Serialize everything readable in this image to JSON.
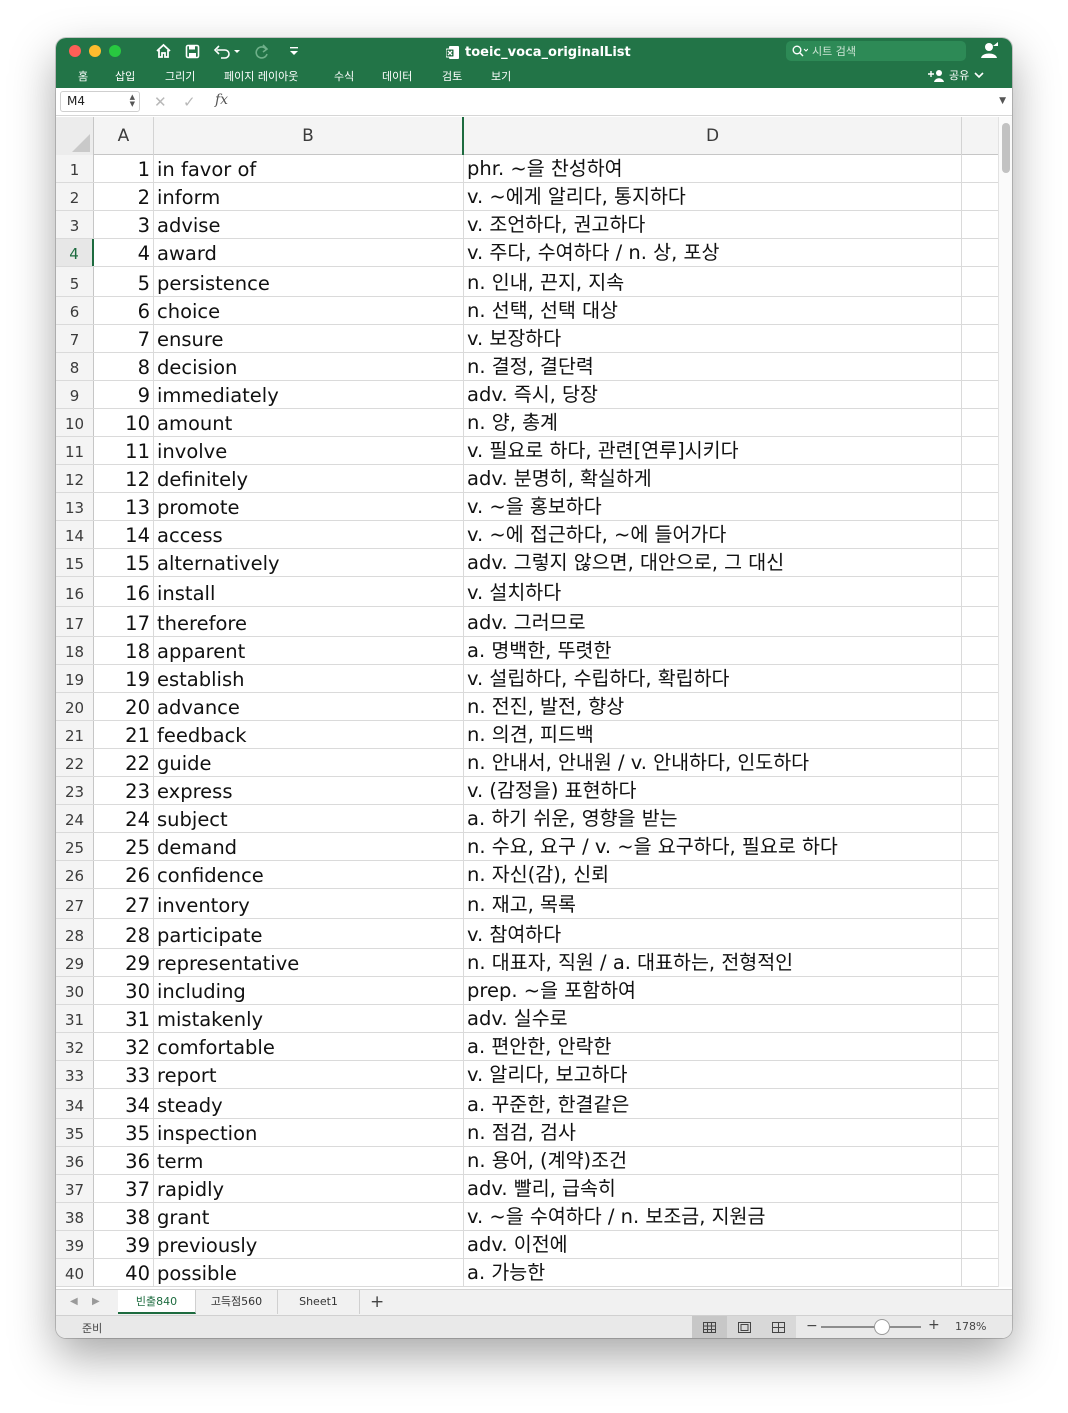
{
  "window": {
    "title": "toeic_voca_originalList",
    "search_placeholder": "시트 검색",
    "share_label": "공유"
  },
  "menu": [
    "홈",
    "삽입",
    "그리기",
    "페이지 레이아웃",
    "수식",
    "데이터",
    "검토",
    "보기"
  ],
  "formula_bar": {
    "cell_ref": "M4",
    "fx": "fx",
    "formula": ""
  },
  "columns": [
    "A",
    "B",
    "D"
  ],
  "rows": [
    {
      "r": "1",
      "n": "1",
      "word": "in favor of",
      "meaning": "phr.  ~을 찬성하여"
    },
    {
      "r": "2",
      "n": "2",
      "word": "inform",
      "meaning": "v. ~에게 알리다, 통지하다"
    },
    {
      "r": "3",
      "n": "3",
      "word": "advise",
      "meaning": "v. 조언하다, 권고하다"
    },
    {
      "r": "4",
      "n": "4",
      "word": "award",
      "meaning": "v. 주다, 수여하다 / n. 상, 포상"
    },
    {
      "r": "5",
      "n": "5",
      "word": "persistence",
      "meaning": "n. 인내, 끈지, 지속"
    },
    {
      "r": "6",
      "n": "6",
      "word": "choice",
      "meaning": "n. 선택, 선택 대상"
    },
    {
      "r": "7",
      "n": "7",
      "word": "ensure",
      "meaning": "v. 보장하다"
    },
    {
      "r": "8",
      "n": "8",
      "word": "decision",
      "meaning": "n. 결정, 결단력"
    },
    {
      "r": "9",
      "n": "9",
      "word": "immediately",
      "meaning": "adv. 즉시, 당장"
    },
    {
      "r": "10",
      "n": "10",
      "word": "amount",
      "meaning": "n. 양, 총계"
    },
    {
      "r": "11",
      "n": "11",
      "word": "involve",
      "meaning": "v. 필요로 하다, 관련[연루]시키다"
    },
    {
      "r": "12",
      "n": "12",
      "word": "definitely",
      "meaning": "adv. 분명히, 확실하게"
    },
    {
      "r": "13",
      "n": "13",
      "word": "promote",
      "meaning": "v. ~을 홍보하다"
    },
    {
      "r": "14",
      "n": "14",
      "word": "access",
      "meaning": "v. ~에 접근하다, ~에 들어가다"
    },
    {
      "r": "15",
      "n": "15",
      "word": "alternatively",
      "meaning": "adv. 그렇지 않으면, 대안으로, 그 대신"
    },
    {
      "r": "16",
      "n": "16",
      "word": "install",
      "meaning": "v. 설치하다"
    },
    {
      "r": "17",
      "n": "17",
      "word": "therefore",
      "meaning": "adv. 그러므로"
    },
    {
      "r": "18",
      "n": "18",
      "word": "apparent",
      "meaning": "a.  명백한, 뚜렷한"
    },
    {
      "r": "19",
      "n": "19",
      "word": "establish",
      "meaning": "v. 설립하다, 수립하다, 확립하다"
    },
    {
      "r": "20",
      "n": "20",
      "word": "advance",
      "meaning": "n. 전진, 발전, 향상"
    },
    {
      "r": "21",
      "n": "21",
      "word": "feedback",
      "meaning": "n. 의견, 피드백"
    },
    {
      "r": "22",
      "n": "22",
      "word": "guide",
      "meaning": "n. 안내서, 안내원 / v. 안내하다, 인도하다"
    },
    {
      "r": "23",
      "n": "23",
      "word": "express",
      "meaning": "v. (감정을) 표현하다"
    },
    {
      "r": "24",
      "n": "24",
      "word": "subject",
      "meaning": "a.  하기 쉬운, 영향을 받는"
    },
    {
      "r": "25",
      "n": "25",
      "word": "demand",
      "meaning": "n. 수요, 요구 / v. ~을 요구하다, 필요로 하다"
    },
    {
      "r": "26",
      "n": "26",
      "word": "confidence",
      "meaning": "n. 자신(감), 신뢰"
    },
    {
      "r": "27",
      "n": "27",
      "word": "inventory",
      "meaning": "n. 재고, 목록"
    },
    {
      "r": "28",
      "n": "28",
      "word": "participate",
      "meaning": "v. 참여하다"
    },
    {
      "r": "29",
      "n": "29",
      "word": "representative",
      "meaning": "n. 대표자, 직원 / a. 대표하는, 전형적인"
    },
    {
      "r": "30",
      "n": "30",
      "word": "including",
      "meaning": "prep. ~을 포함하여"
    },
    {
      "r": "31",
      "n": "31",
      "word": "mistakenly",
      "meaning": "adv. 실수로"
    },
    {
      "r": "32",
      "n": "32",
      "word": "comfortable",
      "meaning": "a.  편안한, 안락한"
    },
    {
      "r": "33",
      "n": "33",
      "word": "report",
      "meaning": "v. 알리다, 보고하다"
    },
    {
      "r": "34",
      "n": "34",
      "word": "steady",
      "meaning": "a.  꾸준한, 한결같은"
    },
    {
      "r": "35",
      "n": "35",
      "word": "inspection",
      "meaning": "n. 점검, 검사"
    },
    {
      "r": "36",
      "n": "36",
      "word": "term",
      "meaning": "n. 용어, (계약)조건"
    },
    {
      "r": "37",
      "n": "37",
      "word": "rapidly",
      "meaning": "adv. 빨리, 급속히"
    },
    {
      "r": "38",
      "n": "38",
      "word": "grant",
      "meaning": "v. ~을 수여하다 / n. 보조금, 지원금"
    },
    {
      "r": "39",
      "n": "39",
      "word": "previously",
      "meaning": "adv. 이전에"
    },
    {
      "r": "40",
      "n": "40",
      "word": "possible",
      "meaning": "a.  가능한"
    }
  ],
  "active_row": "4",
  "sheets": [
    "빈출840",
    "고득점560",
    "Sheet1"
  ],
  "active_sheet": "빈출840",
  "status": {
    "ready": "준비",
    "zoom": "178%"
  },
  "colors": {
    "accent": "#227447",
    "active": "#1d6b3f"
  }
}
